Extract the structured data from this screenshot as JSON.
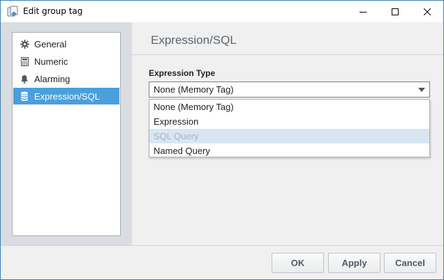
{
  "window": {
    "title": "Edit group tag"
  },
  "sidebar": {
    "items": [
      {
        "label": "General",
        "icon": "gear-icon",
        "active": false
      },
      {
        "label": "Numeric",
        "icon": "calculator-icon",
        "active": false
      },
      {
        "label": "Alarming",
        "icon": "bell-icon",
        "active": false
      },
      {
        "label": "Expression/SQL",
        "icon": "database-icon",
        "active": true
      }
    ]
  },
  "content": {
    "section_title": "Expression/SQL",
    "expression_type": {
      "label": "Expression Type",
      "selected": "None (Memory Tag)",
      "options": [
        "None (Memory Tag)",
        "Expression",
        "SQL Query",
        "Named Query"
      ],
      "hovered_option": "SQL Query"
    }
  },
  "footer": {
    "ok_label": "OK",
    "apply_label": "Apply",
    "cancel_label": "Cancel"
  },
  "colors": {
    "accent": "#4a9fdc",
    "hover": "#d8e6f3",
    "border": "#3c7fb1"
  }
}
